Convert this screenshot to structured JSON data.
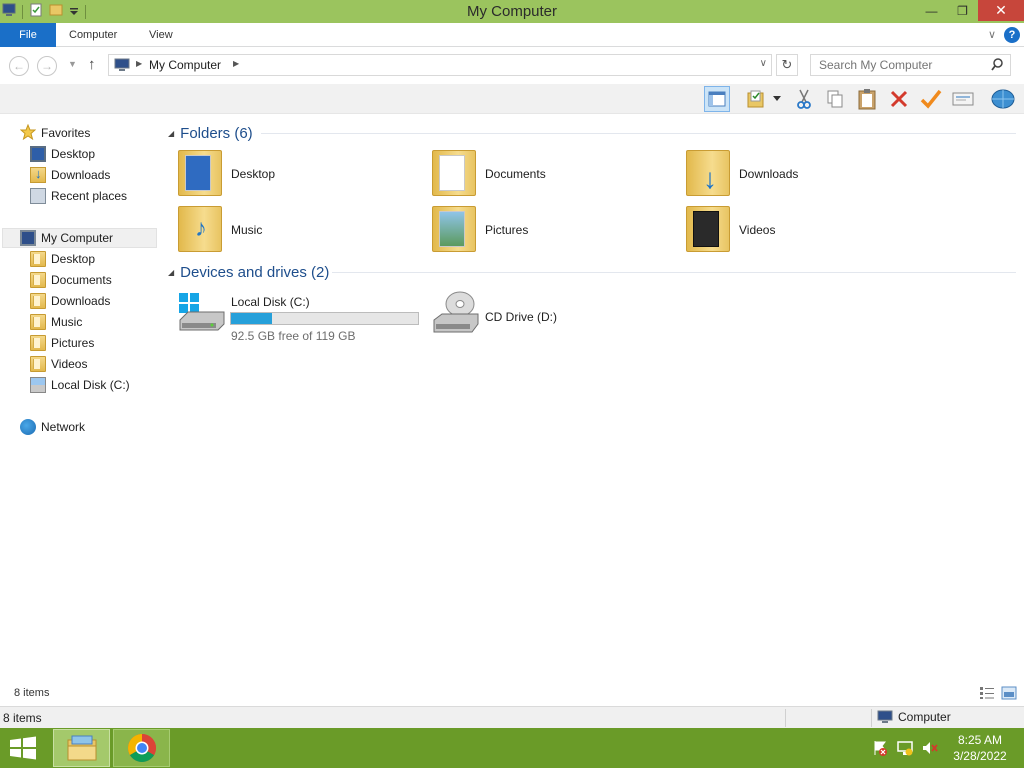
{
  "window": {
    "title": "My Computer",
    "minimize": "—",
    "restore": "❐",
    "close": "✕"
  },
  "ribbon": {
    "tabs": [
      "File",
      "Computer",
      "View"
    ]
  },
  "address": {
    "path": "My Computer",
    "search_placeholder": "Search My Computer"
  },
  "nav": {
    "favorites": {
      "label": "Favorites",
      "items": [
        "Desktop",
        "Downloads",
        "Recent places"
      ]
    },
    "computer": {
      "label": "My Computer",
      "items": [
        "Desktop",
        "Documents",
        "Downloads",
        "Music",
        "Pictures",
        "Videos",
        "Local Disk (C:)"
      ]
    },
    "network": {
      "label": "Network"
    }
  },
  "folders": {
    "heading": "Folders (6)",
    "items": [
      "Desktop",
      "Documents",
      "Downloads",
      "Music",
      "Pictures",
      "Videos"
    ]
  },
  "devices": {
    "heading": "Devices and drives (2)",
    "local": {
      "name": "Local Disk (C:)",
      "free_text": "92.5 GB free of 119 GB",
      "used_fraction": 0.22
    },
    "cd": {
      "name": "CD Drive (D:)"
    }
  },
  "status": {
    "items_text": "8 items",
    "items_text_bottom": "8 items",
    "zone": "Computer"
  },
  "taskbar": {
    "time": "8:25 AM",
    "date": "3/28/2022"
  },
  "colors": {
    "title_bar": "#9bc45e",
    "taskbar": "#6a9b28",
    "file_tab": "#1a6fc8",
    "group_heading": "#1e4e8c",
    "disk_fill": "#26a0da"
  }
}
